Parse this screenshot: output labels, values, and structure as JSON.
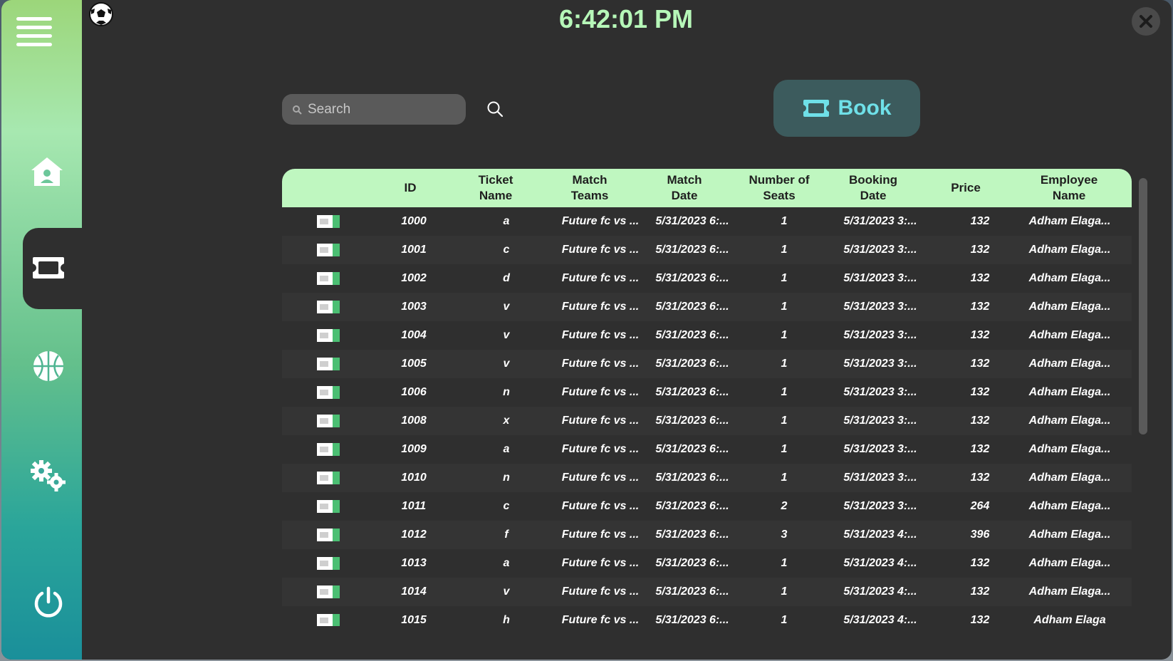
{
  "clock": "6:42:01 PM",
  "search": {
    "placeholder": "Search"
  },
  "book_button": {
    "label": "Book"
  },
  "sidebar": {
    "items": [
      {
        "icon": "menu-icon"
      },
      {
        "icon": "home-icon"
      },
      {
        "icon": "ticket-icon",
        "active": true
      },
      {
        "icon": "basketball-icon"
      },
      {
        "icon": "gears-icon"
      },
      {
        "icon": "power-icon"
      }
    ]
  },
  "colors": {
    "accent": "#bff7c0",
    "clock": "#b6f7b8",
    "book_text": "#6fe0e8",
    "book_bg": "#3c5b5d",
    "window_bg": "#2f2f2f"
  },
  "table": {
    "headers": {
      "id": "ID",
      "ticket_name_1": "Ticket",
      "ticket_name_2": "Name",
      "match_teams_1": "Match",
      "match_teams_2": "Teams",
      "match_date_1": "Match",
      "match_date_2": "Date",
      "seats_1": "Number of",
      "seats_2": "Seats",
      "booking_date_1": "Booking",
      "booking_date_2": "Date",
      "price": "Price",
      "employee_1": "Employee",
      "employee_2": "Name"
    },
    "rows": [
      {
        "id": "1000",
        "name": "a",
        "teams": "Future fc vs ...",
        "match_date": "5/31/2023 6:...",
        "seats": "1",
        "booking_date": "5/31/2023 3:...",
        "price": "132",
        "employee": "Adham Elaga..."
      },
      {
        "id": "1001",
        "name": "c",
        "teams": "Future fc vs ...",
        "match_date": "5/31/2023 6:...",
        "seats": "1",
        "booking_date": "5/31/2023 3:...",
        "price": "132",
        "employee": "Adham Elaga..."
      },
      {
        "id": "1002",
        "name": "d",
        "teams": "Future fc vs ...",
        "match_date": "5/31/2023 6:...",
        "seats": "1",
        "booking_date": "5/31/2023 3:...",
        "price": "132",
        "employee": "Adham Elaga..."
      },
      {
        "id": "1003",
        "name": "v",
        "teams": "Future fc vs ...",
        "match_date": "5/31/2023 6:...",
        "seats": "1",
        "booking_date": "5/31/2023 3:...",
        "price": "132",
        "employee": "Adham Elaga..."
      },
      {
        "id": "1004",
        "name": "v",
        "teams": "Future fc vs ...",
        "match_date": "5/31/2023 6:...",
        "seats": "1",
        "booking_date": "5/31/2023 3:...",
        "price": "132",
        "employee": "Adham Elaga..."
      },
      {
        "id": "1005",
        "name": "v",
        "teams": "Future fc vs ...",
        "match_date": "5/31/2023 6:...",
        "seats": "1",
        "booking_date": "5/31/2023 3:...",
        "price": "132",
        "employee": "Adham Elaga..."
      },
      {
        "id": "1006",
        "name": "n",
        "teams": "Future fc vs ...",
        "match_date": "5/31/2023 6:...",
        "seats": "1",
        "booking_date": "5/31/2023 3:...",
        "price": "132",
        "employee": "Adham Elaga..."
      },
      {
        "id": "1008",
        "name": "x",
        "teams": "Future fc vs ...",
        "match_date": "5/31/2023 6:...",
        "seats": "1",
        "booking_date": "5/31/2023 3:...",
        "price": "132",
        "employee": "Adham Elaga..."
      },
      {
        "id": "1009",
        "name": "a",
        "teams": "Future fc vs ...",
        "match_date": "5/31/2023 6:...",
        "seats": "1",
        "booking_date": "5/31/2023 3:...",
        "price": "132",
        "employee": "Adham Elaga..."
      },
      {
        "id": "1010",
        "name": "n",
        "teams": "Future fc vs ...",
        "match_date": "5/31/2023 6:...",
        "seats": "1",
        "booking_date": "5/31/2023 3:...",
        "price": "132",
        "employee": "Adham Elaga..."
      },
      {
        "id": "1011",
        "name": "c",
        "teams": "Future fc vs ...",
        "match_date": "5/31/2023 6:...",
        "seats": "2",
        "booking_date": "5/31/2023 3:...",
        "price": "264",
        "employee": "Adham Elaga..."
      },
      {
        "id": "1012",
        "name": "f",
        "teams": "Future fc vs ...",
        "match_date": "5/31/2023 6:...",
        "seats": "3",
        "booking_date": "5/31/2023 4:...",
        "price": "396",
        "employee": "Adham Elaga..."
      },
      {
        "id": "1013",
        "name": "a",
        "teams": "Future fc vs ...",
        "match_date": "5/31/2023 6:...",
        "seats": "1",
        "booking_date": "5/31/2023 4:...",
        "price": "132",
        "employee": "Adham Elaga..."
      },
      {
        "id": "1014",
        "name": "v",
        "teams": "Future fc vs ...",
        "match_date": "5/31/2023 6:...",
        "seats": "1",
        "booking_date": "5/31/2023 4:...",
        "price": "132",
        "employee": "Adham Elaga..."
      },
      {
        "id": "1015",
        "name": "h",
        "teams": "Future fc vs ...",
        "match_date": "5/31/2023 6:...",
        "seats": "1",
        "booking_date": "5/31/2023 4:...",
        "price": "132",
        "employee": "Adham Elaga"
      }
    ]
  }
}
